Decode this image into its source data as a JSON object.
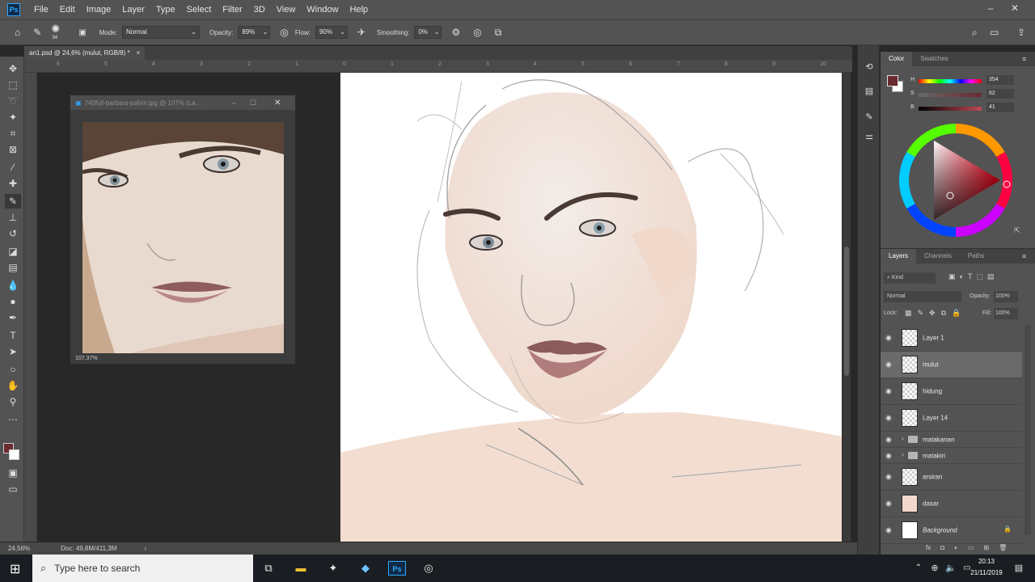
{
  "app": {
    "name": "Ps"
  },
  "menu": [
    "File",
    "Edit",
    "Image",
    "Layer",
    "Type",
    "Select",
    "Filter",
    "3D",
    "View",
    "Window",
    "Help"
  ],
  "options": {
    "brush_size": "34",
    "mode_label": "Mode:",
    "mode_value": "Normal",
    "opacity_label": "Opacity:",
    "opacity_value": "89%",
    "flow_label": "Flow:",
    "flow_value": "90%",
    "smoothing_label": "Smoothing:",
    "smoothing_value": "0%"
  },
  "document": {
    "tab_title": "an1.psd @ 24,6% (mulut, RGB/8) *",
    "close": "×"
  },
  "ruler": {
    "top_ticks": [
      "6",
      "5",
      "4",
      "3",
      "2",
      "1",
      "0",
      "1",
      "2",
      "3",
      "4",
      "5",
      "6",
      "7",
      "8",
      "9",
      "10"
    ]
  },
  "reference_window": {
    "title": "740full-barbara-palvin.jpg @ 107% (La...",
    "zoom": "107,37%"
  },
  "status": {
    "zoom": "24,56%",
    "doc_size": "Doc: 49,8M/411,3M"
  },
  "color_panel": {
    "tabs": [
      "Color",
      "Swatches"
    ],
    "h_label": "H",
    "h_value": "354",
    "s_label": "S",
    "s_value": "62",
    "b_label": "B",
    "b_value": "41",
    "foreground": "#6b2a30",
    "background": "#ffffff"
  },
  "layers_panel": {
    "tabs": [
      "Layers",
      "Channels",
      "Paths"
    ],
    "filter_label": "Kind",
    "blend_mode": "Normal",
    "opacity_label": "Opacity:",
    "opacity_value": "100%",
    "lock_label": "Lock:",
    "fill_label": "Fill:",
    "fill_value": "100%",
    "layers": [
      {
        "name": "Layer 1",
        "type": "layer",
        "selected": false
      },
      {
        "name": "mulut",
        "type": "layer",
        "selected": true
      },
      {
        "name": "hidung",
        "type": "layer",
        "selected": false
      },
      {
        "name": "Layer 14",
        "type": "layer",
        "selected": false
      },
      {
        "name": "matakanan",
        "type": "group",
        "selected": false
      },
      {
        "name": "matakiri",
        "type": "group",
        "selected": false
      },
      {
        "name": "arsiran",
        "type": "layer",
        "selected": false
      },
      {
        "name": "dasar",
        "type": "layer",
        "selected": false
      },
      {
        "name": "Background",
        "type": "layer",
        "selected": false,
        "locked": true
      }
    ],
    "footer_fx": "fx"
  },
  "taskbar": {
    "search_placeholder": "Type here to search",
    "time": "20:13",
    "date": "21/11/2019"
  }
}
